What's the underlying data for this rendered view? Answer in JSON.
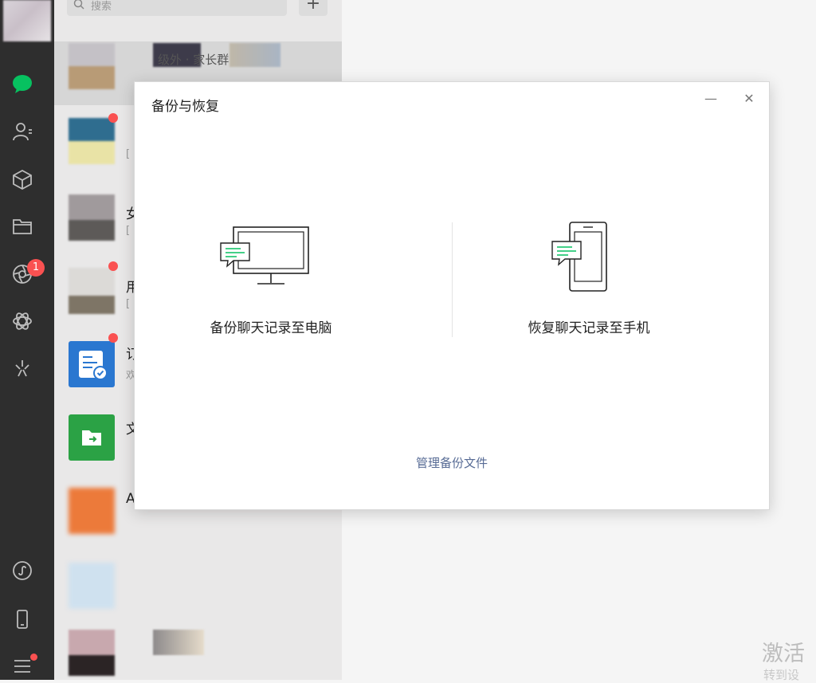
{
  "search": {
    "placeholder": "搜索",
    "add": "+"
  },
  "sidebar": {
    "moments_badge": "1"
  },
  "chatlist": {
    "rows": [
      {
        "title": "级外 · 家长群",
        "sub": ""
      },
      {
        "title": "",
        "sub": "["
      },
      {
        "title": "女",
        "sub": "["
      },
      {
        "title": "用",
        "sub": "["
      },
      {
        "title": "订",
        "sub": "欢"
      },
      {
        "title": "文",
        "sub": ""
      },
      {
        "title": "A",
        "sub": ""
      }
    ]
  },
  "dialog": {
    "title": "备份与恢复",
    "minimize": "—",
    "close": "✕",
    "backup_label": "备份聊天记录至电脑",
    "restore_label": "恢复聊天记录至手机",
    "manage_link": "管理备份文件"
  },
  "watermark": {
    "line1": "激活",
    "line2": "转到设"
  },
  "colors": {
    "accent_green": "#07c160",
    "link": "#576b95",
    "badge_red": "#fa5151"
  }
}
